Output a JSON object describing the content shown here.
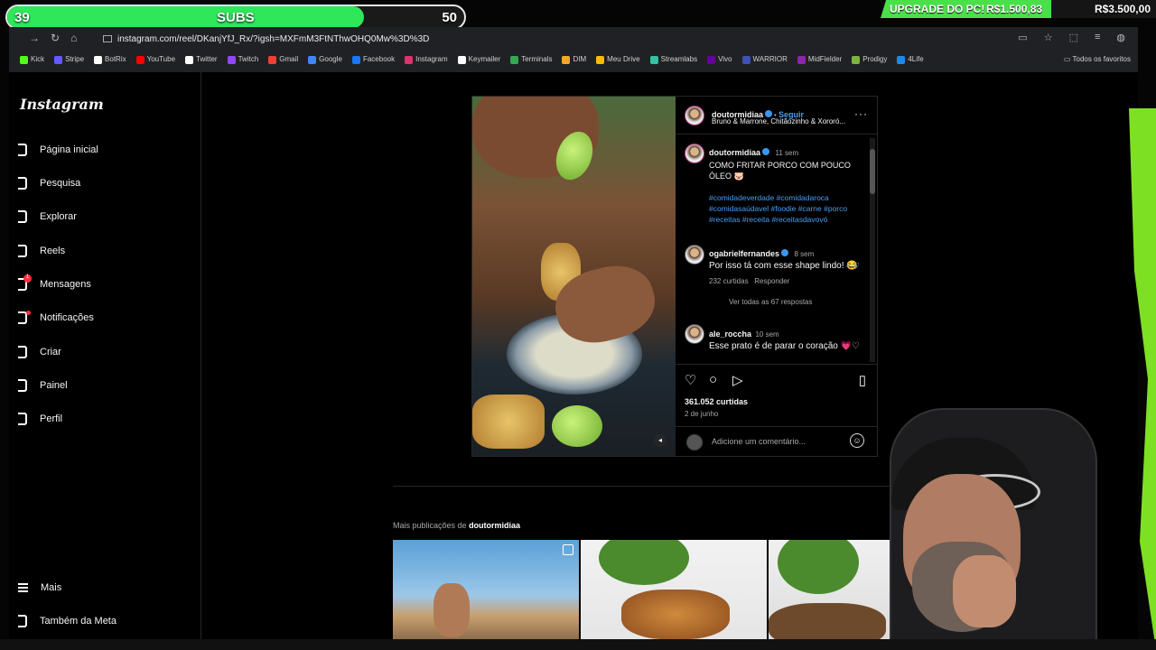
{
  "overlay": {
    "subs_current": "39",
    "subs_label": "SUBS",
    "subs_goal": "50",
    "subs_progress": 0.78,
    "goal_label": "UPGRADE DO PC!",
    "goal_current": "R$1.500,83",
    "goal_target": "R$3.500,00"
  },
  "browser": {
    "url": "instagram.com/reel/DKanjYfJ_Rx/?igsh=MXFmM3FtNThwOHQ0Mw%3D%3D",
    "bookmarks": [
      {
        "label": "Kick",
        "color": "#53fc18"
      },
      {
        "label": "Stripe",
        "color": "#635bff"
      },
      {
        "label": "BotRix",
        "color": "#ffffff"
      },
      {
        "label": "YouTube",
        "color": "#ff0000"
      },
      {
        "label": "Twitter",
        "color": "#ffffff"
      },
      {
        "label": "Twitch",
        "color": "#9146ff"
      },
      {
        "label": "Gmail",
        "color": "#ea4335"
      },
      {
        "label": "Google",
        "color": "#4285f4"
      },
      {
        "label": "Facebook",
        "color": "#1877f2"
      },
      {
        "label": "Instagram",
        "color": "#e1306c"
      },
      {
        "label": "Keymailer",
        "color": "#ffffff"
      },
      {
        "label": "Terminals",
        "color": "#34a853"
      },
      {
        "label": "DIM",
        "color": "#f5a623"
      },
      {
        "label": "Meu Drive",
        "color": "#fbbc04"
      },
      {
        "label": "Streamlabs",
        "color": "#31c3a2"
      },
      {
        "label": "Vivo",
        "color": "#660099"
      },
      {
        "label": "WARRIOR",
        "color": "#3f51b5"
      },
      {
        "label": "MidFielder",
        "color": "#8e24aa"
      },
      {
        "label": "Prodigy",
        "color": "#7cb342"
      },
      {
        "label": "4Life",
        "color": "#1e88e5"
      }
    ],
    "bookmark_folder": "Todos os favoritos"
  },
  "instagram": {
    "logo": "Instagram",
    "nav": [
      {
        "label": "Página inicial"
      },
      {
        "label": "Pesquisa"
      },
      {
        "label": "Explorar"
      },
      {
        "label": "Reels"
      },
      {
        "label": "Mensagens",
        "badge": "1"
      },
      {
        "label": "Notificações"
      },
      {
        "label": "Criar"
      },
      {
        "label": "Painel"
      },
      {
        "label": "Perfil"
      }
    ],
    "nav_bottom": [
      {
        "label": "Mais"
      },
      {
        "label": "Também da Meta"
      }
    ],
    "post": {
      "author": "doutormidiaa",
      "follow": "Seguir",
      "audio": "Bruno & Marrone, Chitãozinho & Xororó...",
      "caption_author": "doutormidiaa",
      "caption_time": "11 sem",
      "caption": "COMO FRITAR PORCO COM POUCO ÓLEO 🐷",
      "hashtags": "#comidadeverdade #comidadaroca #comidasaúdavel #foodie #carne #porco #receitas #receita #receitasdavovó",
      "comments": [
        {
          "user": "ogabrielfernandes",
          "time": "8 sem",
          "text": "Por isso tá com esse shape lindo! 😂",
          "likes": "232 curtidas",
          "reply": "Responder",
          "view_replies": "Ver todas as 67 respostas"
        },
        {
          "user": "ale_roccha",
          "time": "10 sem",
          "text": "Esse prato é de parar o coração 💗"
        }
      ],
      "likes": "361.052 curtidas",
      "date": "2 de junho",
      "comment_placeholder": "Adicione um comentário..."
    },
    "more_prefix": "Mais publicações de",
    "more_user": "doutormidiaa"
  },
  "colors": {
    "accent_blue": "#4a9ef5",
    "subs_green": "#2ee85a",
    "overlay_green": "#7ee022"
  }
}
